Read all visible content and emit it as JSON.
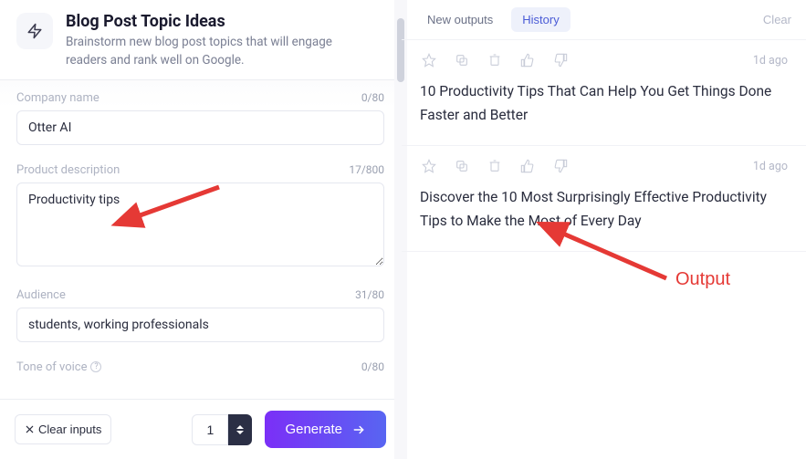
{
  "header": {
    "title": "Blog Post Topic Ideas",
    "subtitle": "Brainstorm new blog post topics that will engage readers and rank well on Google."
  },
  "form": {
    "company": {
      "label": "Company name",
      "value": "Otter AI",
      "count": "0/80"
    },
    "description": {
      "label": "Product description",
      "value": "Productivity tips",
      "count": "17/800"
    },
    "audience": {
      "label": "Audience",
      "value": "students, working professionals",
      "count": "31/80"
    },
    "tone": {
      "label": "Tone of voice",
      "value": "",
      "count": "0/80"
    }
  },
  "footer": {
    "clear_label": "Clear inputs",
    "quantity": "1",
    "generate_label": "Generate"
  },
  "right": {
    "tab_new": "New outputs",
    "tab_history": "History",
    "clear_label": "Clear"
  },
  "outputs": [
    {
      "time": "1d ago",
      "text": "10 Productivity Tips That Can Help You Get Things Done Faster and Better"
    },
    {
      "time": "1d ago",
      "text": "Discover the 10 Most Surprisingly Effective Productivity Tips to Make the Most of Every Day"
    }
  ],
  "annotations": {
    "output_label": "Output"
  }
}
